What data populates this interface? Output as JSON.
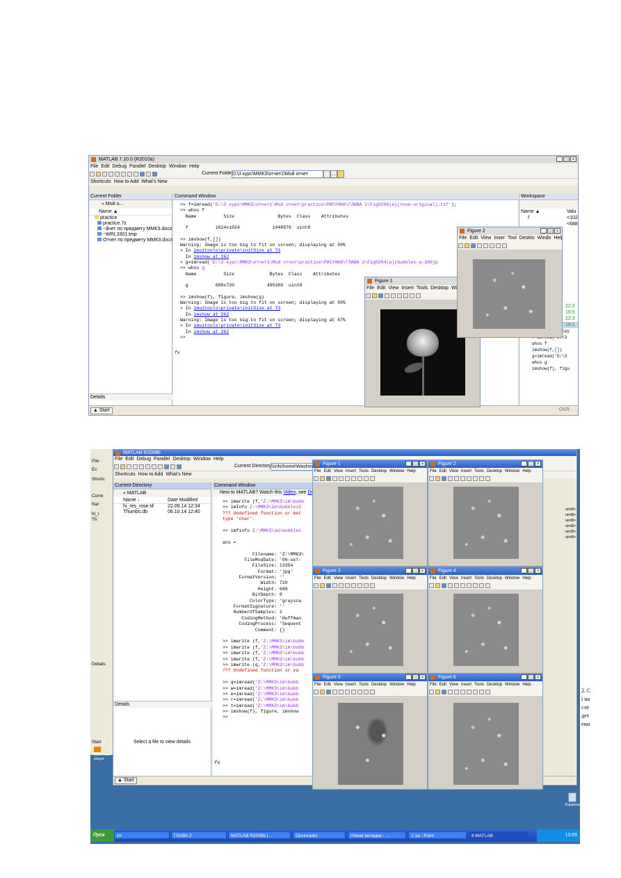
{
  "s1": {
    "title": "MATLAB 7.10.0 (R2010a)",
    "menu": [
      "File",
      "Edit",
      "Debug",
      "Parallel",
      "Desktop",
      "Window",
      "Help"
    ],
    "current_folder_label": "Current Folder:",
    "current_folder_value": "D:\\3 курс\\ММКЗ\\отчет1\\Мой отчет",
    "shortcuts": [
      "Shortcuts",
      "How to Add",
      "What's New"
    ],
    "cf_panel": {
      "title": "Current Folder",
      "path": "« Мой о...",
      "col_name": "Name ▲",
      "items": [
        "practice",
        "practice.7z",
        "~$чет по предмету ММКЗ.docx",
        "~WRL3301.tmp",
        "Отчет по предмету ММКЗ.docx"
      ],
      "details": "Details"
    },
    "cmd_title": "Command Window",
    "cmd_lines": [
      {
        "t": ">> f=imread(",
        "s": "'D:\\3 курс\\ММКЗ\\отчет1\\Мой отчет\\practice\\РИСУНКИ\\ГЛАВА 2\\Fig0206(a)(rose-original).tif'",
        "e": ");"
      },
      {
        "t": ">> whos f",
        "s": "",
        "e": ""
      },
      {
        "t": "  Name          Size                Bytes  Class    Attributes",
        "s": "",
        "e": ""
      },
      {
        "t": "",
        "s": "",
        "e": ""
      },
      {
        "t": "  f          1024x1024            1048576  uint8",
        "s": "",
        "e": ""
      },
      {
        "t": "",
        "s": "",
        "e": ""
      },
      {
        "t": ">> imshow(f,[])",
        "s": "",
        "e": ""
      },
      {
        "t": "Warning: Image is too big to fit on screen; displaying at 50%",
        "s": "",
        "e": ""
      },
      {
        "t": "> In ",
        "l": "imuitools\\private\\initSize at 73",
        "s": "",
        "e": ""
      },
      {
        "t": "  In ",
        "l": "imshow at 262",
        "s": "",
        "e": ""
      },
      {
        "t": "> g=imread(",
        "s": "'D:\\3 курс\\ММКЗ\\отчет1\\Мой отчет\\practice\\РИСУНКИ\\ГЛАВА 2\\Fig0204(a)(bubbles-q-100jp",
        "e": ""
      },
      {
        "t": ">> whos ",
        "s": "g",
        "e": ""
      },
      {
        "t": "  Name          Size             Bytes  Class    Attributes",
        "s": "",
        "e": ""
      },
      {
        "t": "",
        "s": "",
        "e": ""
      },
      {
        "t": "  g          688x720            495360  uint8",
        "s": "",
        "e": ""
      },
      {
        "t": "",
        "s": "",
        "e": ""
      },
      {
        "t": ">> imshow(f), figure, imshow(g)",
        "s": "",
        "e": ""
      },
      {
        "t": "Warning: Image is too big to fit on screen; displaying at 50%",
        "s": "",
        "e": ""
      },
      {
        "t": "> In ",
        "l": "imuitools\\private\\initSize at 73",
        "s": "",
        "e": ""
      },
      {
        "t": "  In ",
        "l": "imshow at 262",
        "s": "",
        "e": ""
      },
      {
        "t": "Warning: Image is too big to fit on screen; displaying at 67%",
        "s": "",
        "e": ""
      },
      {
        "t": "> In ",
        "l": "imuitools\\private\\initSize at 73",
        "s": "",
        "e": ""
      },
      {
        "t": "  In ",
        "l": "imshow at 262",
        "s": "",
        "e": ""
      },
      {
        "t": ">>",
        "s": "",
        "e": ""
      }
    ],
    "workspace": {
      "title": "Workspace",
      "col_name": "Name ▲",
      "col_val": "Valu",
      "items": [
        "f"
      ],
      "vals": [
        "<102",
        "<688"
      ]
    },
    "history": [
      "22:3",
      "16:5",
      "22:3",
      "18:1"
    ],
    "history_cmds": [
      "plot(f,'Display",
      "f=imread('D:\\3",
      "whos f",
      "imshow(f,[])",
      "g=imread('D:\\3",
      "whos g",
      "imshow(f), figu"
    ],
    "figure1": {
      "title": "Figure 1",
      "menu": [
        "File",
        "Edit",
        "View",
        "Insert",
        "Tools",
        "Desktop",
        "Windo"
      ]
    },
    "figure2": {
      "title": "Figure 2",
      "menu": [
        "File",
        "Edit",
        "View",
        "Inser",
        "Tool",
        "Deskto",
        "Windo",
        "Help"
      ]
    },
    "start": "Start",
    "ovr": "OVR"
  },
  "s2": {
    "title": "MATLAB R2008b",
    "menu": [
      "File",
      "Edit",
      "Debug",
      "Parallel",
      "Desktop",
      "Window",
      "Help"
    ],
    "current_dir_label": "Current Directory:",
    "current_dir_value": "\\\\s\\fs\\home\\Washinsk",
    "shortcuts": [
      "Shortcuts",
      "How to Add",
      "What's New"
    ],
    "cd_panel": {
      "title": "Current Directory",
      "path": "« MATLAB",
      "col_name": "Name ↓",
      "col_date": "Date Modified",
      "files": [
        {
          "n": "hi_res_rose.tif",
          "d": "22.09.14 12:34"
        },
        {
          "n": "Thumbs.db",
          "d": "06.10.14 12:40"
        }
      ],
      "details": "Details",
      "select_hint": "Select a file to view details"
    },
    "cmd_title": "Command Window",
    "new_to": "New to MATLAB? Watch this",
    "video": "Video",
    "see": ", see",
    "demos": "Demos",
    "cmd_lines": [
      {
        "t": ">> imwrite (f,",
        "s": "'Z:\\ММКЗ\\im\\bubb",
        "e": ""
      },
      {
        "t": ">> imInfo ",
        "s": "Z:\\ММКЗ\\im\\bubbles2",
        "e": ""
      },
      {
        "t": "??? Undefined function or met",
        "r": true
      },
      {
        "t": "type 'char'.",
        "r": true
      },
      {
        "t": "",
        "s": "",
        "e": ""
      },
      {
        "t": ">> imfinfo ",
        "s": "Z:\\ММКЗ\\im\\bubbles",
        "e": ""
      },
      {
        "t": "",
        "s": "",
        "e": ""
      },
      {
        "t": "ans =",
        "s": "",
        "e": ""
      },
      {
        "t": "",
        "s": "",
        "e": ""
      },
      {
        "t": "           Filename: 'Z:\\ММКЗ\\",
        "s": "",
        "e": ""
      },
      {
        "t": "        FileModDate: '06-окт-",
        "s": "",
        "e": ""
      },
      {
        "t": "           FileSize: 13354",
        "s": "",
        "e": ""
      },
      {
        "t": "             Format: 'jpg'",
        "s": "",
        "e": ""
      },
      {
        "t": "      FormatVersion: ''",
        "s": "",
        "e": ""
      },
      {
        "t": "              Width: 720",
        "s": "",
        "e": ""
      },
      {
        "t": "             Height: 688",
        "s": "",
        "e": ""
      },
      {
        "t": "           BitDepth: 8",
        "s": "",
        "e": ""
      },
      {
        "t": "          ColorType: 'graysca",
        "s": "",
        "e": ""
      },
      {
        "t": "    FormatSignature: ''",
        "s": "",
        "e": ""
      },
      {
        "t": "    NumberOfSamples: 1",
        "s": "",
        "e": ""
      },
      {
        "t": "       CodingMethod: 'Huffman",
        "s": "",
        "e": ""
      },
      {
        "t": "      CodingProcess: 'Sequent",
        "s": "",
        "e": ""
      },
      {
        "t": "            Comment: {}",
        "s": "",
        "e": ""
      },
      {
        "t": "",
        "s": "",
        "e": ""
      },
      {
        "t": ">> imwrite (f,",
        "s": "'Z:\\ММКЗ\\im\\bubb",
        "e": ""
      },
      {
        "t": ">> imwrite (f,",
        "s": "'Z:\\ММКЗ\\im\\bubb",
        "e": ""
      },
      {
        "t": ">> imwrite (f,",
        "s": "'Z:\\ММКЗ\\im\\bubb",
        "e": ""
      },
      {
        "t": ">> imwrite (f,",
        "s": "'Z:\\ММКЗ\\im\\bubb",
        "e": ""
      },
      {
        "t": ">> imwrite (q,",
        "s": "'Z:\\ММКЗ\\im\\bubb",
        "e": ""
      },
      {
        "t": "??? Undefined function or va",
        "r": true
      },
      {
        "t": "",
        "s": "",
        "e": ""
      },
      {
        "t": ">> q=imread(",
        "s": "'Z:\\ММКЗ\\im\\bubb",
        "e": ""
      },
      {
        "t": ">> w=imread(",
        "s": "'Z:\\ММКЗ\\im\\bubb",
        "e": ""
      },
      {
        "t": ">> e=imread(",
        "s": "'Z:\\ММКЗ\\im\\bubb",
        "e": ""
      },
      {
        "t": ">> r=imread(",
        "s": "'Z:\\ММКЗ\\im\\bubb",
        "e": ""
      },
      {
        "t": ">> t=imread(",
        "s": "'Z:\\ММКЗ\\im\\bubb",
        "e": ""
      },
      {
        "t": ">> imshow(f), figure, imshow",
        "s": "",
        "e": ""
      },
      {
        "t": ">>",
        "s": "",
        "e": ""
      }
    ],
    "figures": [
      "Figure 1",
      "Figure 2",
      "Figure 3",
      "Figure 4",
      "Figure 5",
      "Figure 6"
    ],
    "fig_menu": [
      "File",
      "Edit",
      "View",
      "Insert",
      "Tools",
      "Desktop",
      "Window",
      "Help"
    ],
    "ws_vals": [
      "uint8>",
      "uint8>",
      "uint8>",
      "uint8>",
      "uint8>",
      "uint8>"
    ],
    "right_text": [
      "2. C",
      "і на",
      "сле",
      "дет",
      "ени"
    ],
    "left_strip": [
      "File",
      "Ec",
      "Shortc",
      "Curre",
      "Nar",
      "hi_r",
      "Th",
      "Details",
      "Start",
      "VLC med",
      "player"
    ],
    "start": "Start",
    "desktop_icon": "Корзина",
    "taskbar": {
      "start": "Пуск",
      "items": [
        "Im",
        "ГЛАВА 2",
        "MATLAB R2008b |...",
        "Djvureader",
        "Новая вкладка - ...",
        "2.1a - Paint",
        "8 MATLAB"
      ],
      "clock": "13:05"
    }
  }
}
